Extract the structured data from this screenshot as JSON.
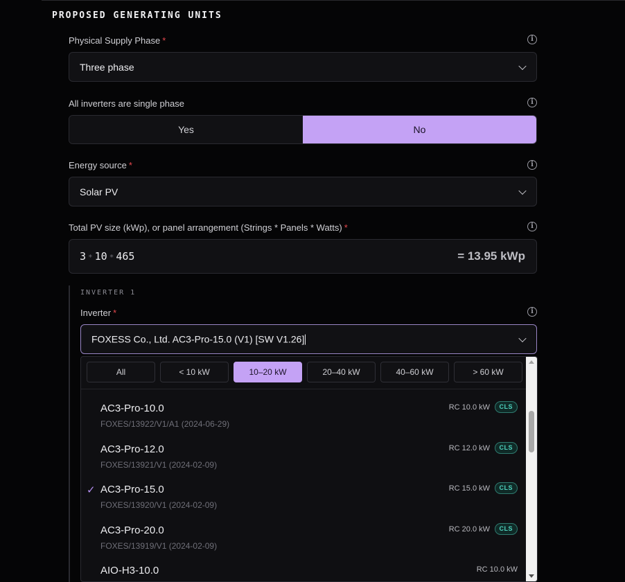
{
  "section_title": "PROPOSED GENERATING UNITS",
  "supply_phase": {
    "label": "Physical Supply Phase",
    "required": "*",
    "value": "Three phase"
  },
  "single_phase": {
    "label": "All inverters are single phase",
    "yes": "Yes",
    "no": "No",
    "selected": "No"
  },
  "energy_source": {
    "label": "Energy source",
    "required": "*",
    "value": "Solar PV"
  },
  "pv_size": {
    "label": "Total PV size (kWp), or panel arrangement (Strings * Panels * Watts)",
    "required": "*",
    "strings": "3",
    "panels": "10",
    "watts": "465",
    "separator": "*",
    "result": "= 13.95 kWp"
  },
  "inverter": {
    "title": "INVERTER 1",
    "label": "Inverter",
    "required": "*",
    "value": "FOXESS Co., Ltd. AC3-Pro-15.0 (V1) [SW V1.26]",
    "filters": [
      "All",
      "< 10 kW",
      "10–20 kW",
      "20–40 kW",
      "40–60 kW",
      "> 60 kW"
    ],
    "active_filter": "10–20 kW",
    "options": [
      {
        "name": "AC3-Pro-10.0",
        "code": "FOXES/13922/V1/A1 (2024-06-29)",
        "rc": "RC 10.0 kW",
        "badge": "CLS",
        "selected": false
      },
      {
        "name": "AC3-Pro-12.0",
        "code": "FOXES/13921/V1 (2024-02-09)",
        "rc": "RC 12.0 kW",
        "badge": "CLS",
        "selected": false
      },
      {
        "name": "AC3-Pro-15.0",
        "code": "FOXES/13920/V1 (2024-02-09)",
        "rc": "RC 15.0 kW",
        "badge": "CLS",
        "selected": true
      },
      {
        "name": "AC3-Pro-20.0",
        "code": "FOXES/13919/V1 (2024-02-09)",
        "rc": "RC 20.0 kW",
        "badge": "CLS",
        "selected": false
      },
      {
        "name": "AIO-H3-10.0",
        "code": "",
        "rc": "RC 10.0 kW",
        "badge": "",
        "selected": false
      }
    ],
    "check_glyph": "✓"
  },
  "info_glyph": "i",
  "colors": {
    "accent": "#c4a2f5",
    "badge_text": "#4fd1bd",
    "required": "#e5484d",
    "background": "#050506"
  }
}
